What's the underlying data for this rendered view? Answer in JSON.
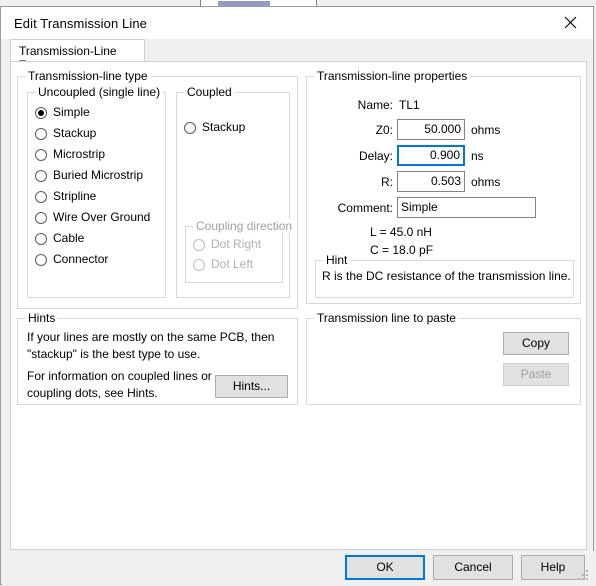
{
  "window": {
    "title": "Edit Transmission Line",
    "close_icon": "close-icon"
  },
  "tabs": [
    {
      "label": "Transmission-Line Type",
      "selected": true
    }
  ],
  "groups": {
    "transmission_line_type": "Transmission-line type",
    "uncoupled": "Uncoupled  (single line)",
    "coupled": "Coupled",
    "coupling_direction": "Coupling direction",
    "hints": "Hints",
    "properties": "Transmission-line properties",
    "hint": "Hint",
    "paste_group": "Transmission line to paste"
  },
  "uncoupled_options": [
    {
      "label": "Simple",
      "selected": true
    },
    {
      "label": "Stackup",
      "selected": false
    },
    {
      "label": "Microstrip",
      "selected": false
    },
    {
      "label": "Buried Microstrip",
      "selected": false
    },
    {
      "label": "Stripline",
      "selected": false
    },
    {
      "label": "Wire Over Ground",
      "selected": false
    },
    {
      "label": "Cable",
      "selected": false
    },
    {
      "label": "Connector",
      "selected": false
    }
  ],
  "coupled_options": [
    {
      "label": "Stackup",
      "selected": false
    }
  ],
  "coupling_direction_options": [
    {
      "label": "Dot Right",
      "selected": false,
      "disabled": true
    },
    {
      "label": "Dot Left",
      "selected": false,
      "disabled": true
    }
  ],
  "properties": {
    "name_label": "Name:",
    "name_value": "TL1",
    "z0_label": "Z0:",
    "z0_value": "50.000",
    "z0_units": "ohms",
    "delay_label": "Delay:",
    "delay_value": "0.900",
    "delay_units": "ns",
    "r_label": "R:",
    "r_value": "0.503",
    "r_units": "ohms",
    "comment_label": "Comment:",
    "comment_value": "Simple",
    "inductance": "L =  45.0 nH",
    "capacitance": "C =  18.0 pF"
  },
  "hint_text": "R is the DC resistance of the transmission line.",
  "hints_text": {
    "line1": "If your lines are mostly on the same PCB, then",
    "line2": "\"stackup\" is the best type to use.",
    "line3": "For information on coupled lines or",
    "line4": "coupling dots, see Hints.",
    "button": "Hints..."
  },
  "paste_buttons": {
    "copy": "Copy",
    "paste": "Paste",
    "paste_disabled": true
  },
  "footer_buttons": {
    "ok": "OK",
    "cancel": "Cancel",
    "help": "Help"
  },
  "colors": {
    "accent": "#0078d7",
    "dialog_bg": "#f0f0f0",
    "panel_bg": "#ffffff",
    "button_bg": "#e1e1e1",
    "group_border": "#d8d8d8",
    "disabled_text": "#b0b0b0"
  }
}
